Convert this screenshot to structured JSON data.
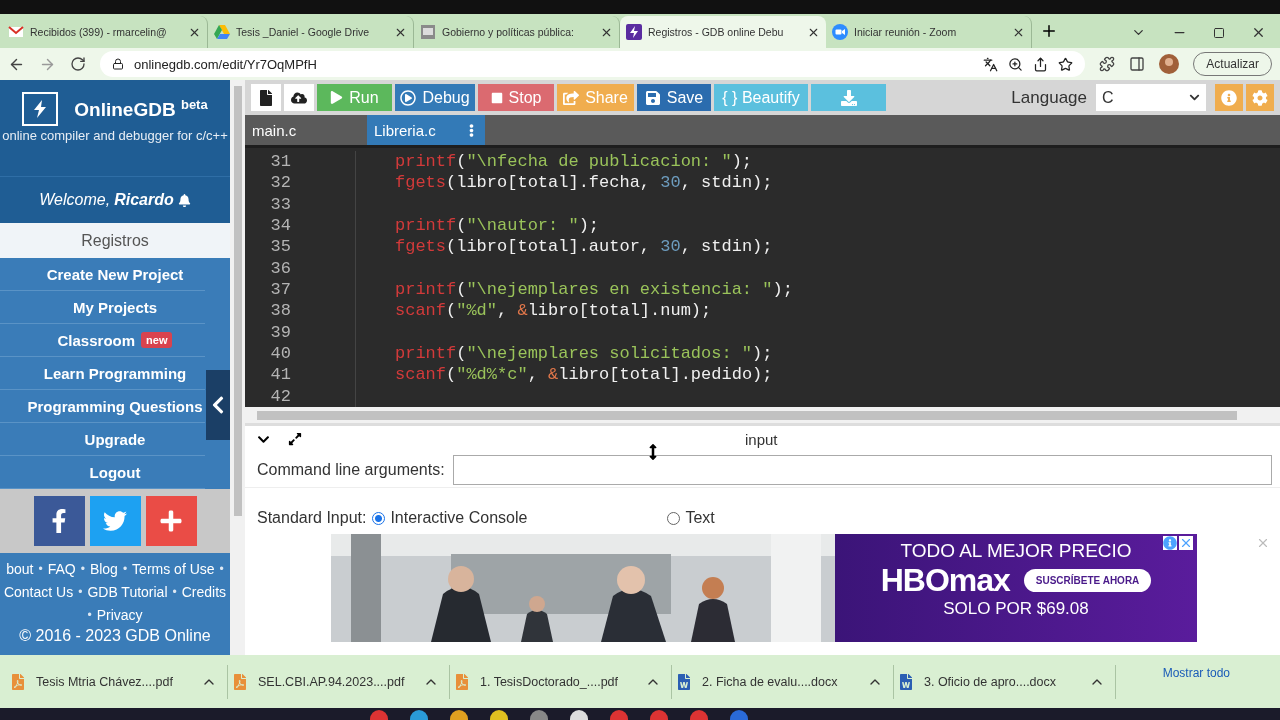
{
  "browser": {
    "tabs": [
      {
        "title": "Recibidos (399) - rmarcelin@",
        "kind": "mail",
        "selected": false
      },
      {
        "title": "Tesis _Daniel - Google Drive",
        "kind": "drive",
        "selected": false
      },
      {
        "title": "Gobierno y políticas pública:",
        "kind": "page",
        "selected": false
      },
      {
        "title": "Registros - GDB online Debu",
        "kind": "gdb",
        "selected": true
      },
      {
        "title": "Iniciar reunión - Zoom",
        "kind": "zoom",
        "selected": false
      }
    ],
    "address": "onlinegdb.com/edit/Yr7OqMPfH",
    "update_button": "Actualizar"
  },
  "sidebar": {
    "brand": "OnlineGDB",
    "brand_sup": "beta",
    "tagline": "online compiler and debugger for c/c++",
    "welcome": "Welcome,",
    "user": "Ricardo",
    "project": "Registros",
    "menu": [
      {
        "label": "Create New Project"
      },
      {
        "label": "My Projects"
      },
      {
        "label": "Classroom",
        "badge": "new"
      },
      {
        "label": "Learn Programming"
      },
      {
        "label": "Programming Questions"
      },
      {
        "label": "Upgrade"
      },
      {
        "label": "Logout"
      }
    ],
    "social": [
      {
        "kind": "facebook"
      },
      {
        "kind": "twitter"
      },
      {
        "kind": "plus"
      }
    ],
    "footer": [
      [
        {
          "kind": "link",
          "text": "bout"
        },
        {
          "kind": "sep",
          "text": "•"
        },
        {
          "kind": "link",
          "text": "FAQ"
        },
        {
          "kind": "sep",
          "text": "•"
        },
        {
          "kind": "link",
          "text": "Blog"
        },
        {
          "kind": "sep",
          "text": "•"
        },
        {
          "kind": "link",
          "text": "Terms of Use"
        },
        {
          "kind": "sep",
          "text": "•"
        }
      ],
      [
        {
          "kind": "link",
          "text": "Contact Us"
        },
        {
          "kind": "sep",
          "text": "•"
        },
        {
          "kind": "link",
          "text": "GDB Tutorial"
        },
        {
          "kind": "sep",
          "text": "•"
        },
        {
          "kind": "link",
          "text": "Credits"
        }
      ],
      [
        {
          "kind": "sep",
          "text": "•"
        },
        {
          "kind": "link",
          "text": "Privacy"
        }
      ]
    ],
    "copyright": "© 2016 - 2023 GDB Online"
  },
  "toolbar": {
    "buttons": [
      {
        "kind": "new"
      },
      {
        "kind": "upload"
      },
      {
        "kind": "run",
        "label": "Run"
      },
      {
        "kind": "debug",
        "label": "Debug"
      },
      {
        "kind": "stop",
        "label": "Stop"
      },
      {
        "kind": "share",
        "label": "Share"
      },
      {
        "kind": "save",
        "label": "Save"
      },
      {
        "kind": "beautify",
        "label": "{ } Beautify"
      },
      {
        "kind": "download"
      }
    ],
    "language_label": "Language",
    "language": "C"
  },
  "file_tabs": [
    {
      "label": "main.c",
      "selected": false
    },
    {
      "label": "Libreria.c",
      "selected": true
    }
  ],
  "code": [
    {
      "n": "31",
      "tokens": [
        {
          "kind": "fn",
          "text": "printf"
        },
        {
          "kind": "plain",
          "text": "("
        },
        {
          "kind": "str",
          "text": "\"\\nfecha de publicacion: \""
        },
        {
          "kind": "plain",
          "text": ");"
        }
      ]
    },
    {
      "n": "32",
      "tokens": [
        {
          "kind": "fn",
          "text": "fgets"
        },
        {
          "kind": "plain",
          "text": "(libro[total].fecha, "
        },
        {
          "kind": "num",
          "text": "30"
        },
        {
          "kind": "plain",
          "text": ", stdin);"
        }
      ]
    },
    {
      "n": "33"
    },
    {
      "n": "34",
      "tokens": [
        {
          "kind": "fn",
          "text": "printf"
        },
        {
          "kind": "plain",
          "text": "("
        },
        {
          "kind": "str",
          "text": "\"\\nautor: \""
        },
        {
          "kind": "plain",
          "text": ");"
        }
      ]
    },
    {
      "n": "35",
      "tokens": [
        {
          "kind": "fn",
          "text": "fgets"
        },
        {
          "kind": "plain",
          "text": "(libro[total].autor, "
        },
        {
          "kind": "num",
          "text": "30"
        },
        {
          "kind": "plain",
          "text": ", stdin);"
        }
      ]
    },
    {
      "n": "36"
    },
    {
      "n": "37",
      "tokens": [
        {
          "kind": "fn",
          "text": "printf"
        },
        {
          "kind": "plain",
          "text": "("
        },
        {
          "kind": "str",
          "text": "\"\\nejemplares en existencia: \""
        },
        {
          "kind": "plain",
          "text": ");"
        }
      ]
    },
    {
      "n": "38",
      "tokens": [
        {
          "kind": "fn",
          "text": "scanf"
        },
        {
          "kind": "plain",
          "text": "("
        },
        {
          "kind": "str",
          "text": "\"%d\""
        },
        {
          "kind": "plain",
          "text": ", "
        },
        {
          "kind": "op",
          "text": "&"
        },
        {
          "kind": "plain",
          "text": "libro[total].num);"
        }
      ]
    },
    {
      "n": "39"
    },
    {
      "n": "40",
      "tokens": [
        {
          "kind": "fn",
          "text": "printf"
        },
        {
          "kind": "plain",
          "text": "("
        },
        {
          "kind": "str",
          "text": "\"\\nejemplares solicitados: \""
        },
        {
          "kind": "plain",
          "text": ");"
        }
      ]
    },
    {
      "n": "41",
      "tokens": [
        {
          "kind": "fn",
          "text": "scanf"
        },
        {
          "kind": "plain",
          "text": "("
        },
        {
          "kind": "str",
          "text": "\"%d%*c\""
        },
        {
          "kind": "plain",
          "text": ", "
        },
        {
          "kind": "op",
          "text": "&"
        },
        {
          "kind": "plain",
          "text": "libro[total].pedido);"
        }
      ]
    },
    {
      "n": "42"
    }
  ],
  "input_panel": {
    "title": "input",
    "args_label": "Command line arguments:",
    "stdin_label": "Standard Input:",
    "stdin_options": [
      {
        "label": "Interactive Console",
        "selected": true
      },
      {
        "label": "Text",
        "selected": false
      }
    ]
  },
  "ad": {
    "headline": "TODO AL MEJOR PRECIO",
    "logo": "HBOmax",
    "cta": "SUSCRÍBETE AHORA",
    "price": "SOLO POR $69.08"
  },
  "downloads": {
    "files": [
      {
        "name": "Tesis Mtria Chávez....pdf",
        "kind": "pdf"
      },
      {
        "name": "SEL.CBI.AP.94.2023....pdf",
        "kind": "pdf"
      },
      {
        "name": "1. TesisDoctorado_....pdf",
        "kind": "pdf"
      },
      {
        "name": "2. Ficha de evalu....docx",
        "kind": "docx"
      },
      {
        "name": "3. Oficio de apro....docx",
        "kind": "docx"
      }
    ],
    "show_all": "Mostrar todo"
  }
}
